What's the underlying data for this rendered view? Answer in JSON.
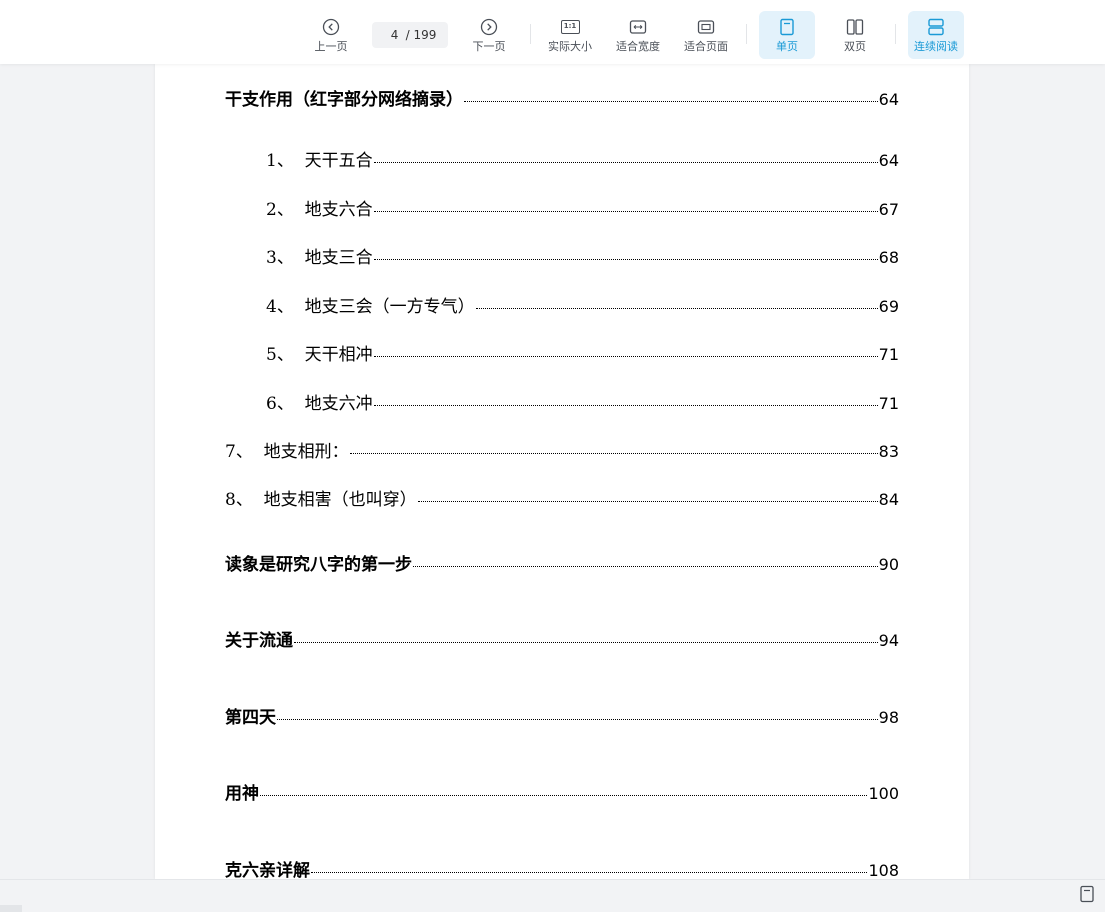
{
  "toolbar": {
    "prev_label": "上一页",
    "next_label": "下一页",
    "current_page": "4",
    "total_pages": "/ 199",
    "actual_size_label": "实际大小",
    "fit_width_label": "适合宽度",
    "fit_page_label": "适合页面",
    "single_page_label": "单页",
    "double_page_label": "双页",
    "continuous_label": "连续阅读",
    "actual_size_icon_text": "1:1",
    "accent_color": "#1a9ad6"
  },
  "toc": [
    {
      "num": "",
      "label": "干支作用（红字部分网络摘录）",
      "page": "64",
      "style": "main"
    },
    {
      "num": "1、  ",
      "label": "天干五合",
      "page": "64",
      "style": "sub"
    },
    {
      "num": "2、  ",
      "label": "地支六合",
      "page": "67",
      "style": "sub"
    },
    {
      "num": "3、  ",
      "label": "地支三合",
      "page": "68",
      "style": "sub"
    },
    {
      "num": "4、  ",
      "label": "地支三会（一方专气）",
      "page": "69",
      "style": "sub"
    },
    {
      "num": "5、  ",
      "label": "天干相冲",
      "page": "71",
      "style": "sub"
    },
    {
      "num": "6、  ",
      "label": "地支六冲",
      "page": "71",
      "style": "sub"
    },
    {
      "num": "7、  ",
      "label": "地支相刑：",
      "page": "83",
      "style": "sub"
    },
    {
      "num": "8、  ",
      "label": "地支相害（也叫穿）",
      "page": "84",
      "style": "sub"
    },
    {
      "num": "",
      "label": "读象是研究八字的第一步",
      "page": "90",
      "style": "main"
    },
    {
      "num": "",
      "label": "关于流通",
      "page": "94",
      "style": "main"
    },
    {
      "num": "",
      "label": "第四天",
      "page": "98",
      "style": "main"
    },
    {
      "num": "",
      "label": "用神",
      "page": "100",
      "style": "main"
    },
    {
      "num": "",
      "label": "克六亲详解",
      "page": "108",
      "style": "main"
    }
  ]
}
